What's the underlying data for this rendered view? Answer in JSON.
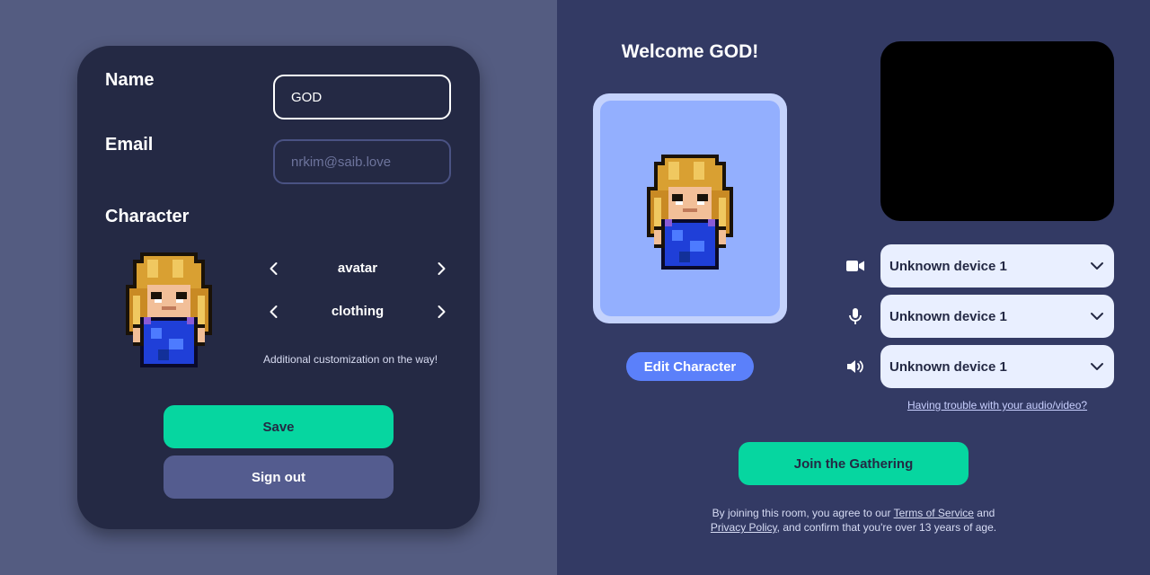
{
  "profile": {
    "name_label": "Name",
    "name_value": "GOD",
    "email_label": "Email",
    "email_placeholder": "nrkim@saib.love",
    "character_label": "Character",
    "options": [
      {
        "label": "avatar"
      },
      {
        "label": "clothing"
      }
    ],
    "customization_note": "Additional customization on the way!",
    "save_label": "Save",
    "signout_label": "Sign out"
  },
  "lobby": {
    "welcome": "Welcome GOD!",
    "edit_character_label": "Edit Character",
    "devices": [
      {
        "icon": "video-camera-icon",
        "value": "Unknown device 1"
      },
      {
        "icon": "microphone-icon",
        "value": "Unknown device 1"
      },
      {
        "icon": "speaker-icon",
        "value": "Unknown device 1"
      }
    ],
    "trouble_link": "Having trouble with your audio/video?",
    "join_label": "Join the Gathering",
    "terms": {
      "prefix": "By joining this room, you agree to our",
      "tos_link": "Terms of Service",
      "and": "and",
      "privacy_link": "Privacy Policy",
      "suffix": ", and confirm that you're over 13 years of age."
    }
  },
  "colors": {
    "left_bg": "#545c81",
    "right_bg": "#333a64",
    "card_bg": "#242944",
    "accent_green": "#06d6a0",
    "accent_blue": "#5b80fa",
    "preview_bg": "#93affe"
  }
}
